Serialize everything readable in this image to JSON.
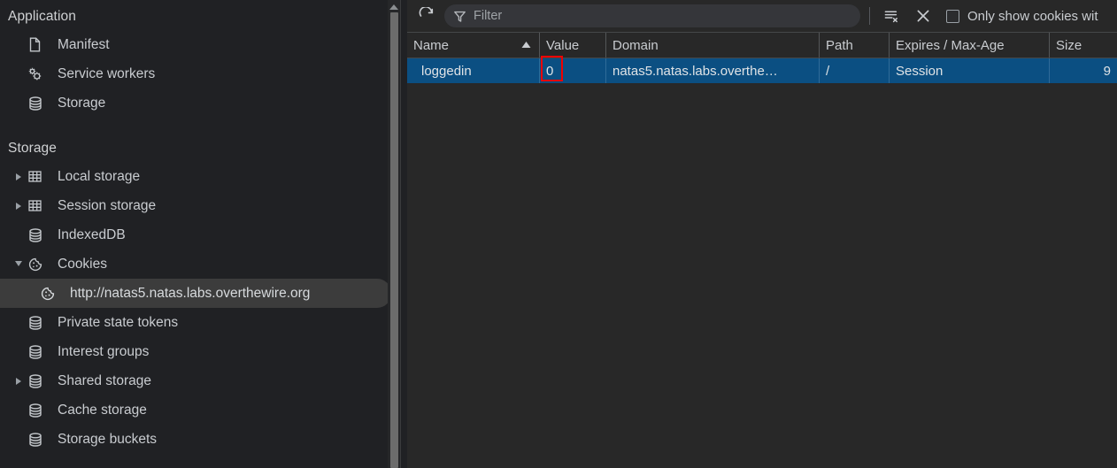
{
  "sidebar": {
    "application_section": {
      "title": "Application",
      "items": [
        {
          "label": "Manifest",
          "icon": "document-icon",
          "twisty": "none"
        },
        {
          "label": "Service workers",
          "icon": "gears-icon",
          "twisty": "none"
        },
        {
          "label": "Storage",
          "icon": "database-icon",
          "twisty": "none"
        }
      ]
    },
    "storage_section": {
      "title": "Storage",
      "items": [
        {
          "label": "Local storage",
          "icon": "table-icon",
          "twisty": "collapsed"
        },
        {
          "label": "Session storage",
          "icon": "table-icon",
          "twisty": "collapsed"
        },
        {
          "label": "IndexedDB",
          "icon": "database-icon",
          "twisty": "none"
        },
        {
          "label": "Cookies",
          "icon": "cookie-icon",
          "twisty": "expanded"
        },
        {
          "label": "http://natas5.natas.labs.overthewire.org",
          "icon": "cookie-icon",
          "twisty": "none",
          "selected": true,
          "child": true
        },
        {
          "label": "Private state tokens",
          "icon": "database-icon",
          "twisty": "none"
        },
        {
          "label": "Interest groups",
          "icon": "database-icon",
          "twisty": "none"
        },
        {
          "label": "Shared storage",
          "icon": "database-icon",
          "twisty": "collapsed"
        },
        {
          "label": "Cache storage",
          "icon": "database-icon",
          "twisty": "none"
        },
        {
          "label": "Storage buckets",
          "icon": "database-icon",
          "twisty": "none"
        }
      ]
    }
  },
  "toolbar": {
    "refresh_title": "Refresh",
    "filter_placeholder": "Filter",
    "filter_value": "",
    "clear_filtered_title": "Clear filtered cookies",
    "delete_title": "Delete selected cookie",
    "checkbox_label": "Only show cookies wit",
    "checkbox_checked": false
  },
  "table": {
    "columns": [
      {
        "key": "name",
        "label": "Name",
        "sort": "ascending"
      },
      {
        "key": "value",
        "label": "Value",
        "sort": "none"
      },
      {
        "key": "domain",
        "label": "Domain",
        "sort": "none"
      },
      {
        "key": "path",
        "label": "Path",
        "sort": "none"
      },
      {
        "key": "expires",
        "label": "Expires / Max-Age",
        "sort": "none"
      },
      {
        "key": "size",
        "label": "Size",
        "sort": "none"
      }
    ],
    "rows": [
      {
        "name": "loggedin",
        "value": "0",
        "domain": "natas5.natas.labs.overthe…",
        "path": "/",
        "expires": "Session",
        "size": "9",
        "selected": true
      }
    ]
  },
  "annotation": {
    "target": "value-cell",
    "color": "#f00000"
  },
  "colors": {
    "selection_blue": "#0b4f82",
    "sidebar_bg": "#202124",
    "panel_bg": "#282828",
    "selected_tree_bg": "#3c3c3c"
  }
}
